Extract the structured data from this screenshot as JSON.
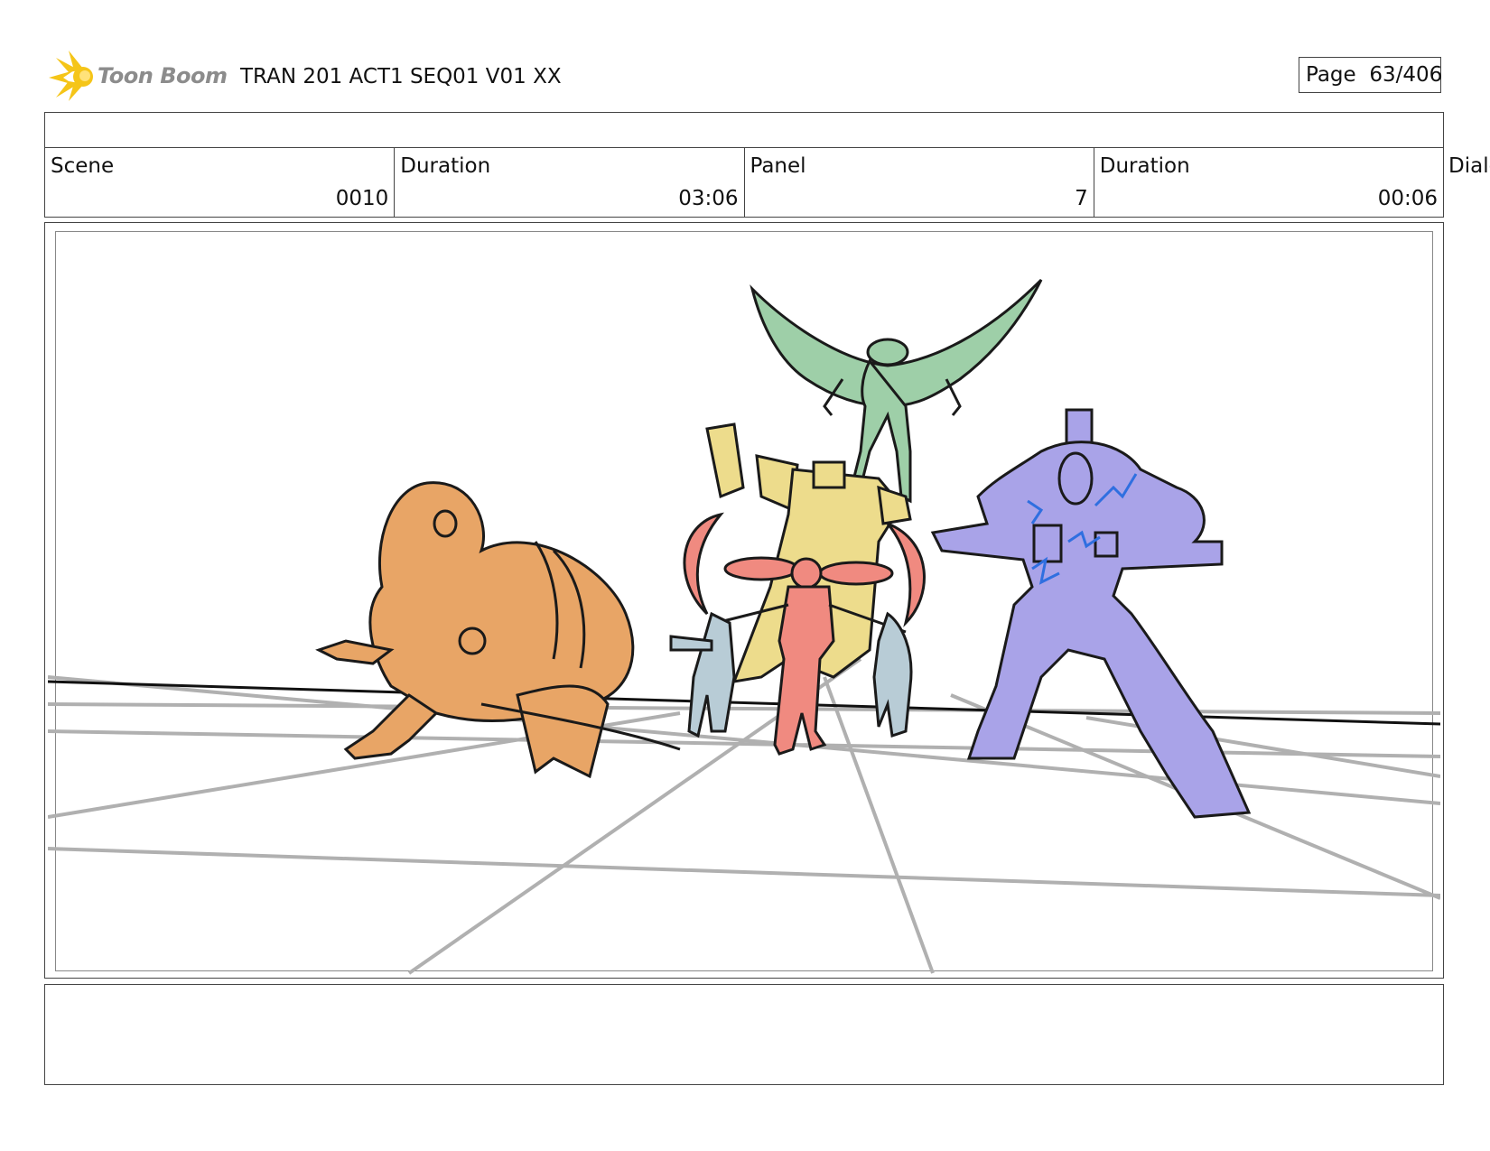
{
  "header": {
    "logo_text": "Toon Boom",
    "project_title": "TRAN 201 ACT1 SEQ01 V01 XX",
    "page_label": "Page",
    "page_value": "63/406"
  },
  "info": {
    "scene_label": "Scene",
    "scene_value": "0010",
    "scene_duration_label": "Duration",
    "scene_duration_value": "03:06",
    "panel_label": "Panel",
    "panel_value": "7",
    "panel_duration_label": "Duration",
    "panel_duration_value": "00:06",
    "dialog_label": "Dialo"
  },
  "panel": {
    "icons": [
      "toon-boom-logo-icon",
      "ground-grid",
      "orange-lizard-character",
      "green-winged-character",
      "yellow-robot-character",
      "red-robot-character",
      "blue-small-figure",
      "purple-robot-character"
    ],
    "colors": {
      "orange": "#e8a566",
      "green": "#9ecfa8",
      "yellow": "#eddc8c",
      "red": "#f08a80",
      "light_blue": "#b8ccd6",
      "purple": "#a9a3e8",
      "electric_blue": "#2f6fe0",
      "grid": "#b0b0b0",
      "logo_yellow": "#f5c518"
    }
  }
}
